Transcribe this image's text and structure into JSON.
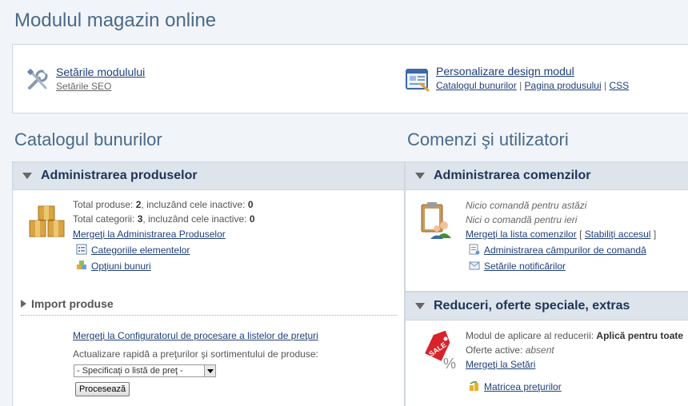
{
  "page": {
    "title": "Modulul magazin online"
  },
  "settings": {
    "module_settings": "Setările modulului",
    "seo_settings": "Setările SEO",
    "design": "Personalizare design modul",
    "design_links": [
      "Catalogul bunurilor",
      "Pagina produsului",
      "CSS"
    ],
    "separator": "|"
  },
  "catalog": {
    "title": "Catalogul bunurilor",
    "panel_title": "Administrarea produselor",
    "total_products_prefix": "Total produse: ",
    "total_products": "2",
    "total_products_mid": ", incluzând cele inactive: ",
    "total_products_inactive": "0",
    "total_categories_prefix": "Total categorii: ",
    "total_categories": "3",
    "total_categories_mid": ", incluzând cele inactive: ",
    "total_categories_inactive": "0",
    "goto_admin": "Mergeţi la Administrarea Produselor",
    "categories_link": "Categoriile elementelor",
    "options_link": "Opţiuni bunuri",
    "import_title": "Import produse",
    "configurator_link": "Mergeţi la Configuratorul de procesare a listelor de preţuri",
    "quick_update_text": "Actualizare rapidă a preţurilor şi sortimentului de produse:",
    "select_value": "- Specificaţi o listă de preţ -",
    "process_button": "Procesează"
  },
  "orders": {
    "title": "Comenzi şi utilizatori",
    "panel_title": "Administrarea comenzilor",
    "none_today": "Nicio comandă pentru astăzi",
    "none_yesterday": "Nici o comandă pentru ieri",
    "goto_orders": "Mergeţi la lista comenzilor",
    "bracket_open": "[",
    "access_link": "Stabiliţi accesul",
    "bracket_close": "]",
    "fields_link": "Administrarea câmpurilor de comandă",
    "notifications_link": "Setările notificărilor"
  },
  "discounts": {
    "panel_title": "Reduceri, oferte speciale, extras",
    "mode_label": "Modul de aplicare al reducerii: ",
    "mode_value": "Aplică pentru toate",
    "offers_label": "Oferte active: ",
    "offers_value": "absent",
    "goto_settings": "Mergeţi la Setări",
    "matrix_link": "Matricea preţurilor",
    "sale_badge": "SALE",
    "percent_sign": "%"
  }
}
